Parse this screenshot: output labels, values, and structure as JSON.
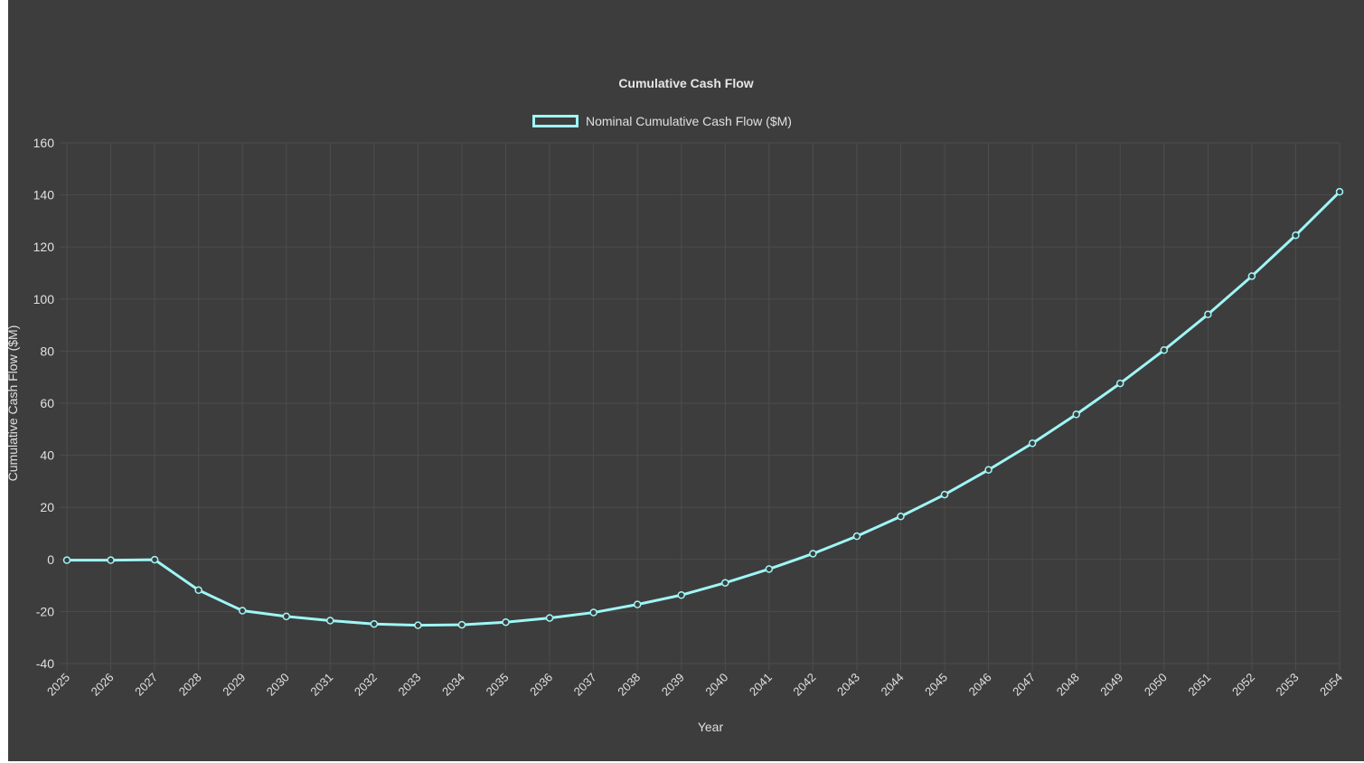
{
  "chart_data": {
    "type": "line",
    "title": "Cumulative Cash Flow",
    "xlabel": "Year",
    "ylabel": "Cumulative Cash Flow ($M)",
    "ylim": [
      -40,
      160
    ],
    "yticks": [
      -40,
      -20,
      0,
      20,
      40,
      60,
      80,
      100,
      120,
      140,
      160
    ],
    "grid": true,
    "legend_position": "top-center",
    "categories": [
      "2025",
      "2026",
      "2027",
      "2028",
      "2029",
      "2030",
      "2031",
      "2032",
      "2033",
      "2034",
      "2035",
      "2036",
      "2037",
      "2038",
      "2039",
      "2040",
      "2041",
      "2042",
      "2043",
      "2044",
      "2045",
      "2046",
      "2047",
      "2048",
      "2049",
      "2050",
      "2051",
      "2052",
      "2053",
      "2054"
    ],
    "series": [
      {
        "name": "Nominal Cumulative Cash Flow ($M)",
        "color": "#9ff6f6",
        "values": [
          -0.3,
          -0.3,
          -0.1,
          -11.8,
          -19.7,
          -21.9,
          -23.5,
          -24.8,
          -25.3,
          -25.1,
          -24.1,
          -22.5,
          -20.4,
          -17.3,
          -13.7,
          -9.0,
          -3.7,
          2.2,
          8.9,
          16.5,
          24.9,
          34.4,
          44.6,
          55.7,
          67.6,
          80.4,
          94.1,
          108.8,
          124.5,
          141.2
        ]
      }
    ]
  }
}
